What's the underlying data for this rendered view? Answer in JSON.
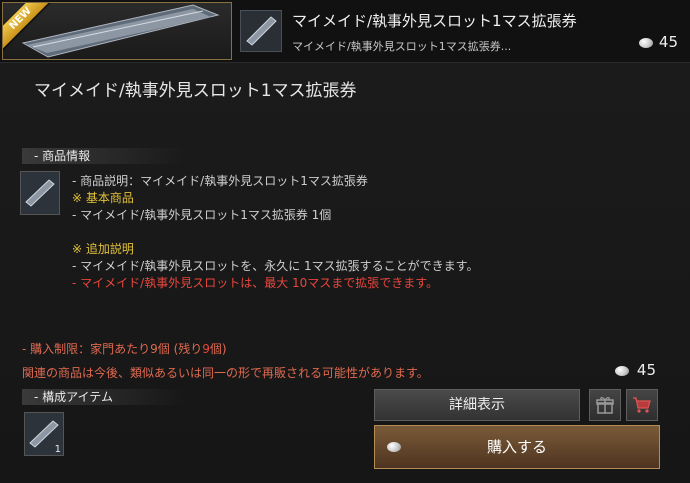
{
  "header": {
    "badge": "NEW",
    "title": "マイメイド/執事外見スロット1マス拡張券",
    "subtitle": "マイメイド/執事外見スロット1マス拡張券...",
    "price": "45"
  },
  "main_title": "マイメイド/執事外見スロット1マス拡張券",
  "product_info": {
    "section_label": "- 商品情報",
    "lines": [
      "- 商品説明：マイメイド/執事外見スロット1マス拡張券",
      "※ 基本商品",
      "- マイメイド/執事外見スロット1マス拡張券 1個",
      "※ 追加説明",
      "- マイメイド/執事外見スロットを、永久に 1マス拡張することができます。",
      "- マイメイド/執事外見スロットは、最大 10マスまで拡張できます。"
    ]
  },
  "purchase_limit": {
    "prefix": "- 購入制限：家門あたり9個 (残り",
    "remaining": "9",
    "suffix": "個)"
  },
  "resale_note": "関連の商品は今後、類似あるいは同一の形で再販される可能性があります。",
  "price": "45",
  "components": {
    "section_label": "- 構成アイテム",
    "quantity": "1"
  },
  "buttons": {
    "detail": "詳細表示",
    "buy": "購入する"
  },
  "colors": {
    "gold_text": "#e2c23a",
    "red_text": "#e8463c",
    "badge": "#e0b030"
  }
}
